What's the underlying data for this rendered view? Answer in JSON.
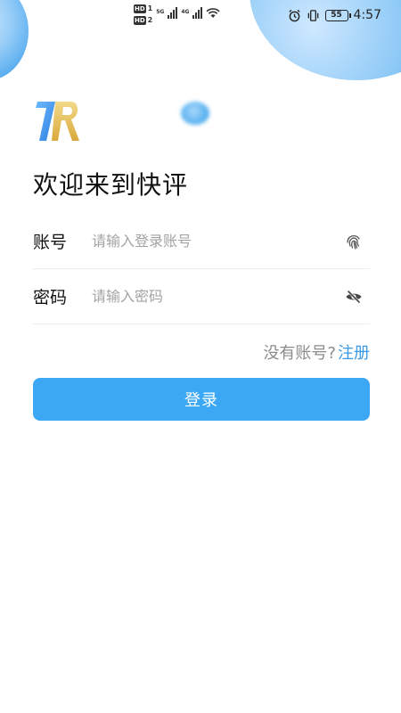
{
  "status_bar": {
    "hd_top": "HD",
    "hd_top_num": "1",
    "hd_bottom": "HD",
    "hd_bottom_num": "2",
    "net1": "5G",
    "net2": "4G",
    "battery": "55",
    "time": "4:57"
  },
  "welcome_title": "欢迎来到快评",
  "form": {
    "account_label": "账号",
    "account_placeholder": "请输入登录账号",
    "account_value": "",
    "password_label": "密码",
    "password_placeholder": "请输入密码",
    "password_value": ""
  },
  "register": {
    "prompt": "没有账号?",
    "link": "注册"
  },
  "login_button": "登录",
  "colors": {
    "accent": "#3ca8f4",
    "link": "#3a9ae8"
  },
  "icons": {
    "account": "fingerprint-icon",
    "password": "eye-off-icon"
  }
}
